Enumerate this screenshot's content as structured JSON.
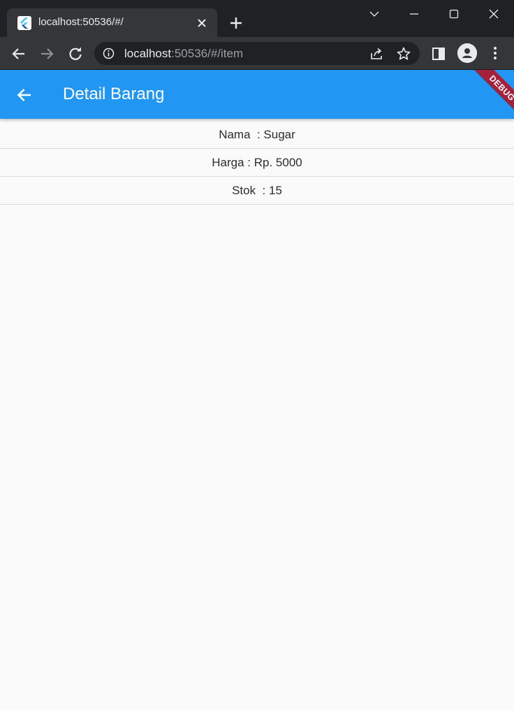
{
  "browser": {
    "tab_title": "localhost:50536/#/",
    "url_host": "localhost",
    "url_rest": ":50536/#/item"
  },
  "icons": {
    "favicon": "flutter-logo-icon",
    "tab_close": "close-icon",
    "new_tab": "plus-icon",
    "back": "arrow-left-icon",
    "forward": "arrow-right-icon",
    "reload": "reload-icon",
    "info": "info-icon",
    "share": "share-icon",
    "bookmark": "star-icon",
    "side_panel": "side-panel-icon",
    "profile": "profile-icon",
    "menu": "kebab-menu-icon"
  },
  "colors": {
    "appbar": "#2196f3",
    "debug_banner": "#a3213d",
    "background": "#fafafa"
  },
  "app": {
    "title": "Detail Barang",
    "debug_label": "DEBUG",
    "rows": [
      {
        "text": "Nama  : Sugar"
      },
      {
        "text": "Harga : Rp. 5000"
      },
      {
        "text": "Stok  : 15"
      }
    ]
  }
}
